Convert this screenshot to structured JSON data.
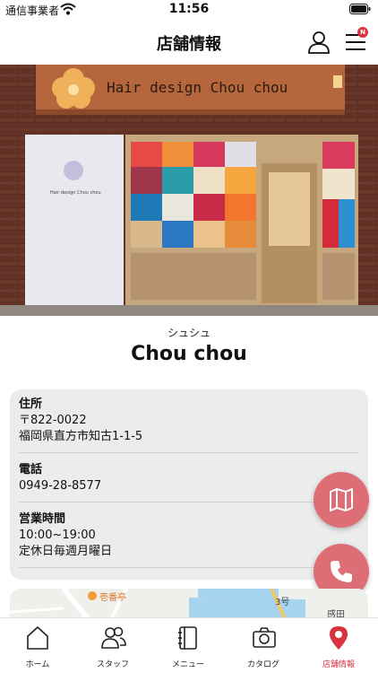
{
  "status_bar": {
    "carrier": "通信事業者",
    "time": "11:56"
  },
  "nav": {
    "title": "店舗情報",
    "badge": "N"
  },
  "hero": {
    "sign_text": "Hair design Chou chou",
    "window_sign_title": "Hair design Chou chou"
  },
  "store": {
    "kana": "シュシュ",
    "name": "Chou chou"
  },
  "info": {
    "address_label": "住所",
    "postal": "〒822-0022",
    "address": "福岡県直方市知古1-1-5",
    "phone_label": "電話",
    "phone": "0949-28-8577",
    "hours_label": "営業時間",
    "hours": "10:00~19:00",
    "closed": "定休日毎週月曜日"
  },
  "map": {
    "poi": "壱番亭",
    "road": "3号",
    "place": "感田"
  },
  "tabs": [
    {
      "label": "ホーム",
      "icon": "home-icon",
      "active": false
    },
    {
      "label": "スタッフ",
      "icon": "staff-icon",
      "active": false
    },
    {
      "label": "メニュー",
      "icon": "menu-book-icon",
      "active": false
    },
    {
      "label": "カタログ",
      "icon": "camera-icon",
      "active": false
    },
    {
      "label": "店舗情報",
      "icon": "location-pin-icon",
      "active": true
    }
  ],
  "colors": {
    "accent": "#d8333f",
    "fab": "#de6e76",
    "card": "#ececec"
  }
}
